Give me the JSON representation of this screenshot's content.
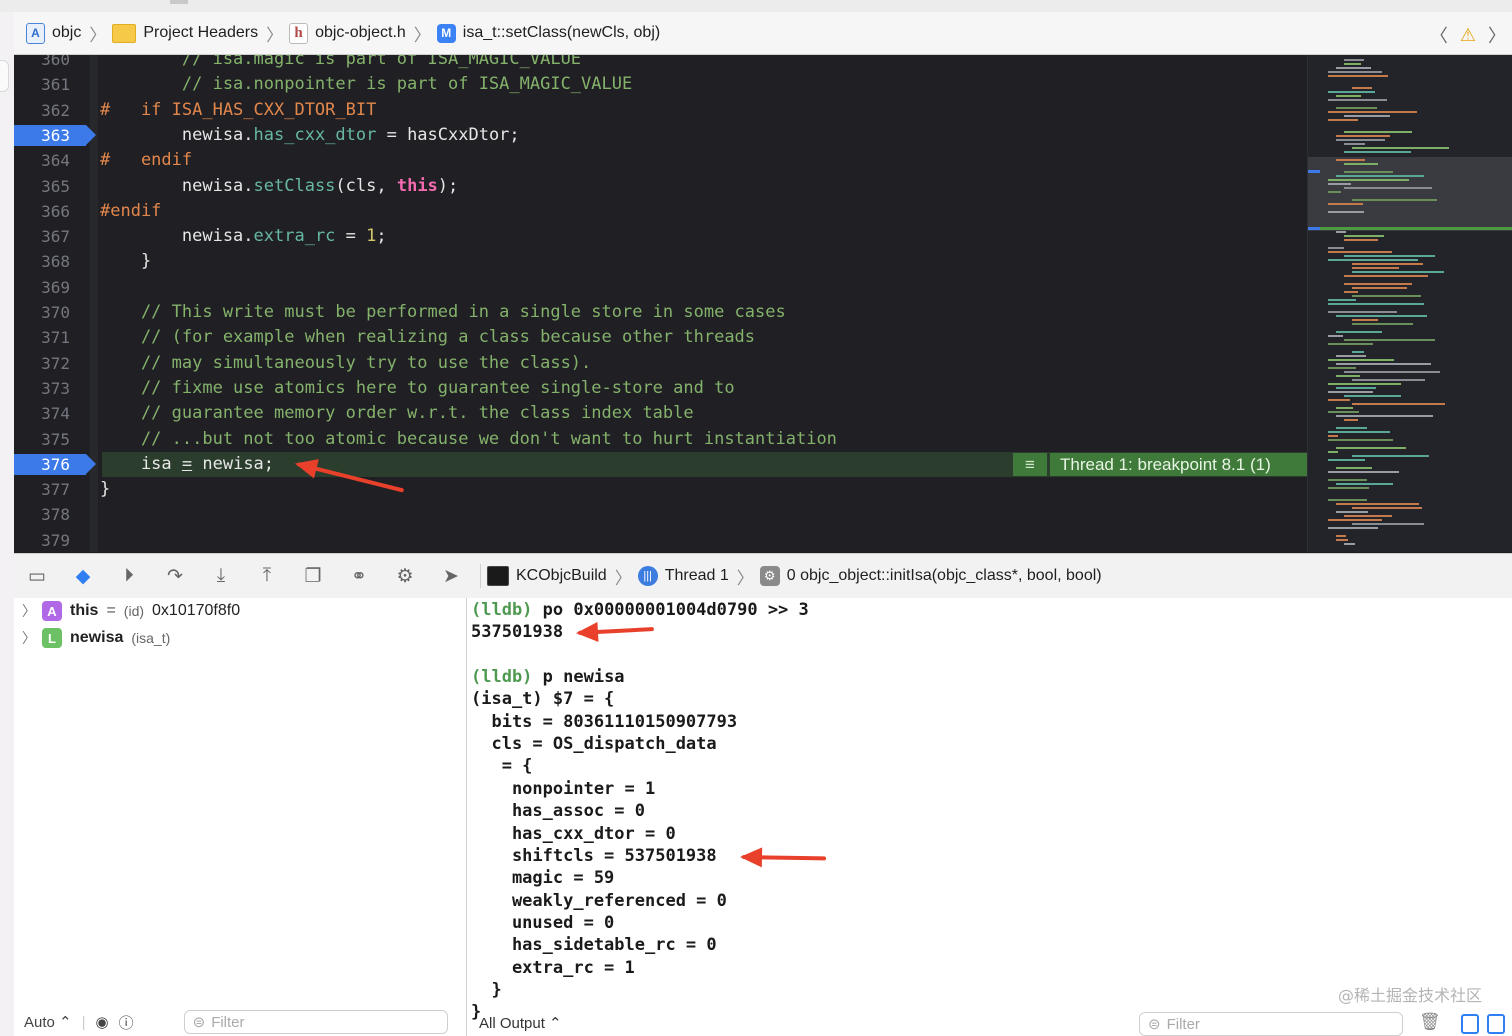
{
  "jumpbar": {
    "items": [
      {
        "label": "objc",
        "icon": "project-icon"
      },
      {
        "label": "Project Headers",
        "icon": "folder-icon"
      },
      {
        "label": "objc-object.h",
        "icon": "header-file-icon"
      },
      {
        "label": "isa_t::setClass(newCls, obj)",
        "icon": "method-icon"
      }
    ]
  },
  "editor": {
    "lines": [
      {
        "n": "360",
        "html": "<span class=\"c-cmt\">        // isa.magic is part of ISA_MAGIC_VALUE</span>"
      },
      {
        "n": "361",
        "html": "<span class=\"c-cmt\">        // isa.nonpointer is part of ISA_MAGIC_VALUE</span>"
      },
      {
        "n": "362",
        "html": "<span class=\"c-pp\">#   if ISA_HAS_CXX_DTOR_BIT</span>"
      },
      {
        "n": "363",
        "html": "        newisa.<span class=\"c-prop\">has_cxx_dtor</span> = hasCxxDtor;",
        "breakpoint": true
      },
      {
        "n": "364",
        "html": "<span class=\"c-pp\">#   endif</span>"
      },
      {
        "n": "365",
        "html": "        newisa.<span class=\"c-prop\">setClass</span>(cls, <span class=\"c-kw\">this</span>);"
      },
      {
        "n": "366",
        "html": "<span class=\"c-pp\">#endif</span>"
      },
      {
        "n": "367",
        "html": "        newisa.<span class=\"c-prop\">extra_rc</span> = <span class=\"c-num\">1</span>;"
      },
      {
        "n": "368",
        "html": "    }"
      },
      {
        "n": "369",
        "html": ""
      },
      {
        "n": "370",
        "html": "<span class=\"c-cmt\">    // This write must be performed in a single store in some cases</span>"
      },
      {
        "n": "371",
        "html": "<span class=\"c-cmt\">    // (for example when realizing a class because other threads</span>"
      },
      {
        "n": "372",
        "html": "<span class=\"c-cmt\">    // may simultaneously try to use the class).</span>"
      },
      {
        "n": "373",
        "html": "<span class=\"c-cmt\">    // fixme use atomics here to guarantee single-store and to</span>"
      },
      {
        "n": "374",
        "html": "<span class=\"c-cmt\">    // guarantee memory order w.r.t. the class index table</span>"
      },
      {
        "n": "375",
        "html": "<span class=\"c-cmt\">    // ...but not too atomic because we don't want to hurt instantiation</span>"
      },
      {
        "n": "376",
        "html": "    isa <u>=</u> newisa;",
        "breakpoint": true,
        "current": true
      },
      {
        "n": "377",
        "html": "}"
      },
      {
        "n": "378",
        "html": ""
      },
      {
        "n": "379",
        "html": ""
      }
    ],
    "thread_badge": "Thread 1: breakpoint 8.1 (1)"
  },
  "debugbar": {
    "target": "KCObjcBuild",
    "thread": "Thread 1",
    "frame": "0 objc_object::initIsa(objc_class*, bool, bool)"
  },
  "variables": [
    {
      "icon": "A",
      "name": "this",
      "type": "(id)",
      "value": "0x10170f8f0"
    },
    {
      "icon": "L",
      "name": "newisa",
      "type": "(isa_t)",
      "value": ""
    }
  ],
  "variables_footer": {
    "scope": "Auto ⌃",
    "filter_placeholder": "Filter"
  },
  "console": {
    "lines": [
      {
        "prompt": "(lldb)",
        "text": " po 0x00000001004d0790 >> 3"
      },
      {
        "prompt": "",
        "text": "537501938"
      },
      {
        "prompt": "",
        "text": ""
      },
      {
        "prompt": "(lldb)",
        "text": " p newisa"
      },
      {
        "prompt": "",
        "text": "(isa_t) $7 = {"
      },
      {
        "prompt": "",
        "text": "  bits = 8036111015090779З"
      },
      {
        "prompt": "",
        "text": "  cls = OS_dispatch_data"
      },
      {
        "prompt": "",
        "text": "   = {"
      },
      {
        "prompt": "",
        "text": "    nonpointer = 1"
      },
      {
        "prompt": "",
        "text": "    has_assoc = 0"
      },
      {
        "prompt": "",
        "text": "    has_cxx_dtor = 0"
      },
      {
        "prompt": "",
        "text": "    shiftcls = 537501938"
      },
      {
        "prompt": "",
        "text": "    magic = 59"
      },
      {
        "prompt": "",
        "text": "    weakly_referenced = 0"
      },
      {
        "prompt": "",
        "text": "    unused = 0"
      },
      {
        "prompt": "",
        "text": "    has_sidetable_rc = 0"
      },
      {
        "prompt": "",
        "text": "    extra_rc = 1"
      },
      {
        "prompt": "",
        "text": "  }"
      },
      {
        "prompt": "",
        "text": "}"
      }
    ],
    "output_selector": "All Output ⌃",
    "filter_placeholder": "Filter"
  },
  "watermark": "@稀土掘金技术社区",
  "colors": {
    "accent": "#3b7ae8",
    "annotation_arrow": "#e8402a",
    "current_line": "#2b3d2c"
  }
}
